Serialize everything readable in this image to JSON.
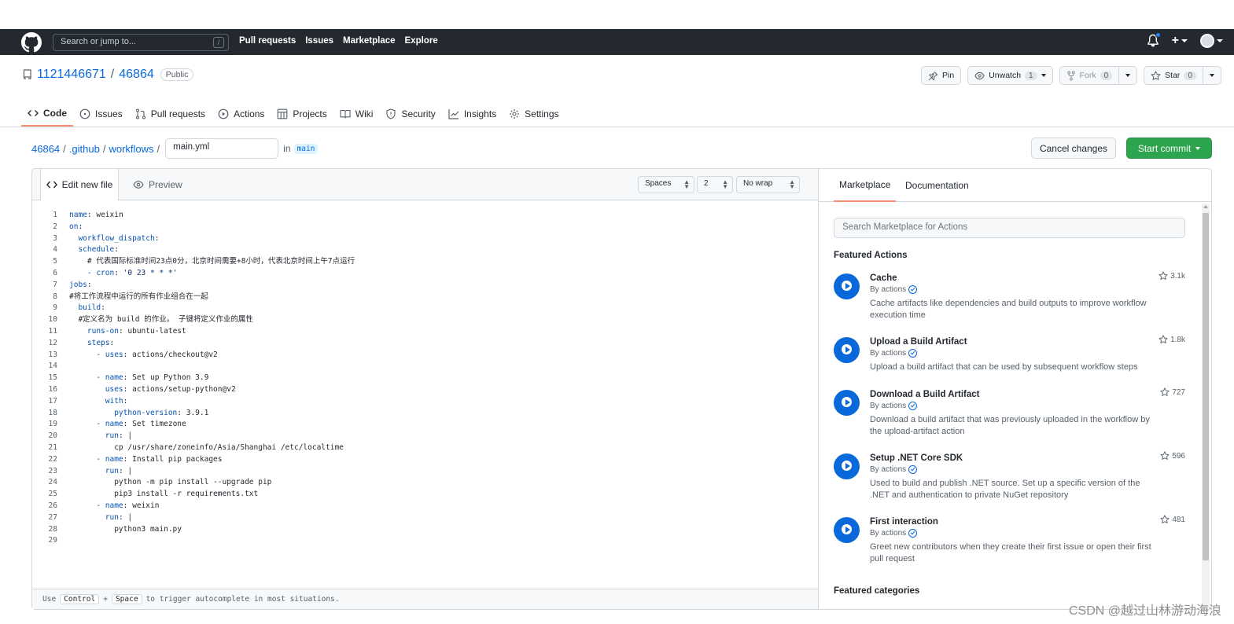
{
  "topbar": {
    "search_placeholder": "Search or jump to...",
    "slash": "/",
    "nav": [
      "Pull requests",
      "Issues",
      "Marketplace",
      "Explore"
    ],
    "plus": "+"
  },
  "repo": {
    "owner": "1121446671",
    "sep": "/",
    "name": "46864",
    "visibility": "Public",
    "pin": "Pin",
    "unwatch": "Unwatch",
    "watch_count": "1",
    "fork": "Fork",
    "fork_count": "0",
    "star": "Star",
    "star_count": "0"
  },
  "tabs": [
    "Code",
    "Issues",
    "Pull requests",
    "Actions",
    "Projects",
    "Wiki",
    "Security",
    "Insights",
    "Settings"
  ],
  "path": {
    "root": "46864",
    "sep": "/",
    "dir1": ".github",
    "dir2": "workflows",
    "filename": "main.yml",
    "in": "in",
    "branch": "main"
  },
  "buttons": {
    "cancel": "Cancel changes",
    "commit": "Start commit"
  },
  "editor": {
    "tab_edit": "Edit new file",
    "tab_preview": "Preview",
    "indent_mode": "Spaces",
    "indent_size": "2",
    "wrap_mode": "No wrap",
    "footer_use": "Use",
    "footer_key1": "Control",
    "footer_plus": "+",
    "footer_key2": "Space",
    "footer_rest": "to trigger autocomplete in most situations.",
    "lines": [
      {
        "n": "1",
        "ind": "",
        "k": "name",
        "v": " weixin"
      },
      {
        "n": "2",
        "ind": "",
        "k": "on",
        "v": ""
      },
      {
        "n": "3",
        "ind": "  ",
        "k": "workflow_dispatch",
        "v": ""
      },
      {
        "n": "4",
        "ind": "  ",
        "k": "schedule",
        "v": ""
      },
      {
        "n": "5",
        "ind": "    ",
        "k": "",
        "v": "# 代表国际标准时间23点0分，北京时间需要+8小时，代表北京时间上午7点运行"
      },
      {
        "n": "6",
        "ind": "    ",
        "k": "- cron",
        "v": " '0 23 * * *'"
      },
      {
        "n": "7",
        "ind": "",
        "k": "jobs",
        "v": ""
      },
      {
        "n": "8",
        "ind": "",
        "k": "",
        "v": "#将工作流程中运行的所有作业组合在一起"
      },
      {
        "n": "9",
        "ind": "  ",
        "k": "build",
        "v": ""
      },
      {
        "n": "10",
        "ind": "  ",
        "k": "",
        "v": "#定义名为 build 的作业。 子键将定义作业的属性"
      },
      {
        "n": "11",
        "ind": "    ",
        "k": "runs-on",
        "v": " ubuntu-latest"
      },
      {
        "n": "12",
        "ind": "    ",
        "k": "steps",
        "v": ""
      },
      {
        "n": "13",
        "ind": "      ",
        "k": "- uses",
        "v": " actions/checkout@v2"
      },
      {
        "n": "14",
        "ind": "",
        "k": "",
        "v": ""
      },
      {
        "n": "15",
        "ind": "      ",
        "k": "- name",
        "v": " Set up Python 3.9"
      },
      {
        "n": "16",
        "ind": "        ",
        "k": "uses",
        "v": " actions/setup-python@v2"
      },
      {
        "n": "17",
        "ind": "        ",
        "k": "with",
        "v": ""
      },
      {
        "n": "18",
        "ind": "          ",
        "k": "python-version",
        "v": " 3.9.1"
      },
      {
        "n": "19",
        "ind": "      ",
        "k": "- name",
        "v": " Set timezone"
      },
      {
        "n": "20",
        "ind": "        ",
        "k": "run",
        "v": " |"
      },
      {
        "n": "21",
        "ind": "          ",
        "k": "",
        "v": "cp /usr/share/zoneinfo/Asia/Shanghai /etc/localtime"
      },
      {
        "n": "22",
        "ind": "      ",
        "k": "- name",
        "v": " Install pip packages"
      },
      {
        "n": "23",
        "ind": "        ",
        "k": "run",
        "v": " |"
      },
      {
        "n": "24",
        "ind": "          ",
        "k": "",
        "v": "python -m pip install --upgrade pip"
      },
      {
        "n": "25",
        "ind": "          ",
        "k": "",
        "v": "pip3 install -r requirements.txt"
      },
      {
        "n": "26",
        "ind": "      ",
        "k": "- name",
        "v": " weixin"
      },
      {
        "n": "27",
        "ind": "        ",
        "k": "run",
        "v": " |"
      },
      {
        "n": "28",
        "ind": "          ",
        "k": "",
        "v": "python3 main.py"
      },
      {
        "n": "29",
        "ind": "",
        "k": "",
        "v": ""
      }
    ]
  },
  "sidebar": {
    "tab_marketplace": "Marketplace",
    "tab_docs": "Documentation",
    "search_placeholder": "Search Marketplace for Actions",
    "featured_title": "Featured Actions",
    "categories_title": "Featured categories",
    "actions": [
      {
        "name": "Cache",
        "by": "By actions",
        "desc": "Cache artifacts like dependencies and build outputs to improve workflow execution time",
        "stars": "3.1k"
      },
      {
        "name": "Upload a Build Artifact",
        "by": "By actions",
        "desc": "Upload a build artifact that can be used by subsequent workflow steps",
        "stars": "1.8k"
      },
      {
        "name": "Download a Build Artifact",
        "by": "By actions",
        "desc": "Download a build artifact that was previously uploaded in the workflow by the upload-artifact action",
        "stars": "727"
      },
      {
        "name": "Setup .NET Core SDK",
        "by": "By actions",
        "desc": "Used to build and publish .NET source. Set up a specific version of the .NET and authentication to private NuGet repository",
        "stars": "596"
      },
      {
        "name": "First interaction",
        "by": "By actions",
        "desc": "Greet new contributors when they create their first issue or open their first pull request",
        "stars": "481"
      }
    ]
  },
  "watermark": "CSDN @越过山林游动海浪",
  "colors": {
    "header_bg": "#24292f",
    "link": "#0969da",
    "commit_green": "#2da44e",
    "active_tab_underline": "#fd8c73"
  }
}
